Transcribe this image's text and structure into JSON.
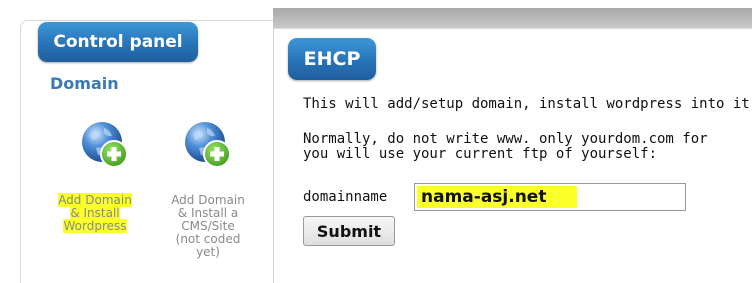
{
  "sidebar": {
    "panel_title": "Control panel",
    "section_heading": "Domain",
    "items": [
      {
        "label": "Add Domain\n& Install\nWordpress",
        "icon": "globe-add-icon",
        "highlighted": true
      },
      {
        "label": "Add Domain\n& Install a\nCMS/Site\n(not coded\nyet)",
        "icon": "globe-add-icon",
        "highlighted": false
      }
    ]
  },
  "main": {
    "tab_title": "EHCP",
    "line1": "This will add/setup domain, install wordpress into it",
    "line2": "Normally, do not write www. only yourdom.com for",
    "line3": "you will use your current ftp of yourself:",
    "field_label": "domainname",
    "field_value": "nama-asj.net",
    "submit_label": "Submit"
  },
  "colors": {
    "tab_blue": "#2873b8",
    "heading_blue": "#3a7ab2",
    "highlight_yellow": "#fbff2a",
    "icon_green": "#5bb82b"
  }
}
